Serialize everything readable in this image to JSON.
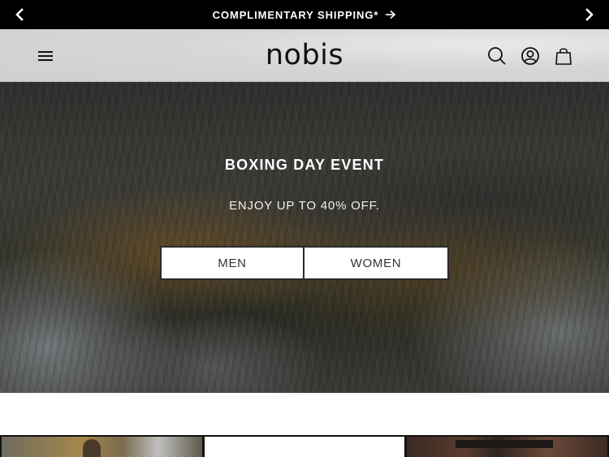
{
  "announcement": {
    "message": "COMPLIMENTARY SHIPPING*",
    "prev_icon": "chevron-left-icon",
    "next_icon": "chevron-right-icon",
    "link_icon": "arrow-right-icon",
    "background": "#000000",
    "text_color": "#ffffff"
  },
  "header": {
    "logo": "nobis",
    "icons": [
      "menu-icon",
      "search-icon",
      "account-icon",
      "shopping-bag-icon"
    ]
  },
  "hero": {
    "title": "BOXING DAY EVENT",
    "subtitle": "ENJOY UP TO 40% OFF.",
    "buttons": {
      "men": "MEN",
      "women": "WOMEN"
    }
  },
  "tiles": {
    "count": 3
  }
}
